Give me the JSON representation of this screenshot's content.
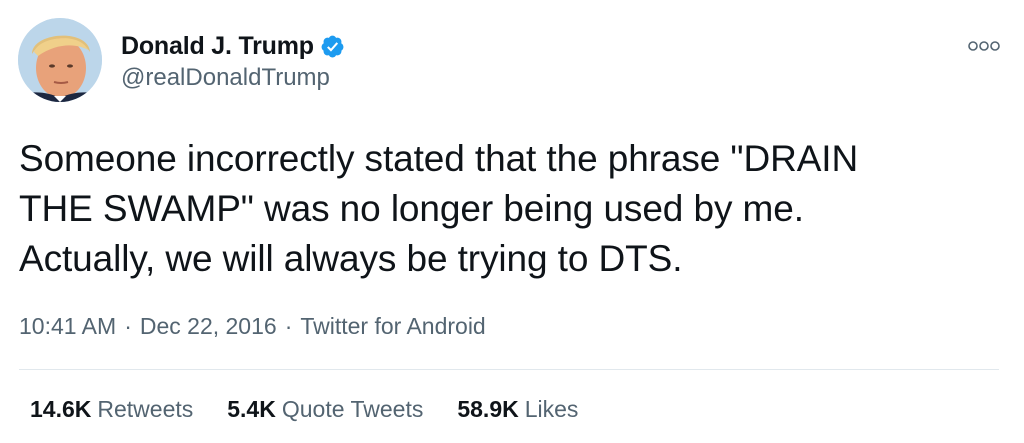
{
  "user": {
    "display_name": "Donald J. Trump",
    "handle": "@realDonaldTrump",
    "verified": true,
    "avatar_icon": "profile-photo"
  },
  "tweet": {
    "text": "Someone incorrectly stated that the phrase \"DRAIN\nTHE SWAMP\" was no longer being used by me.\nActually, we will always be trying to DTS."
  },
  "meta": {
    "time": "10:41 AM",
    "separator": "·",
    "date": "Dec 22, 2016",
    "source": "Twitter for Android"
  },
  "stats": {
    "retweets_count": "14.6K",
    "retweets_label": "Retweets",
    "quote_count": "5.4K",
    "quote_label": "Quote Tweets",
    "likes_count": "58.9K",
    "likes_label": "Likes"
  },
  "colors": {
    "text": "#0f1419",
    "secondary": "#536471",
    "verified": "#1d9bf0",
    "divider": "#e1e8ed"
  }
}
